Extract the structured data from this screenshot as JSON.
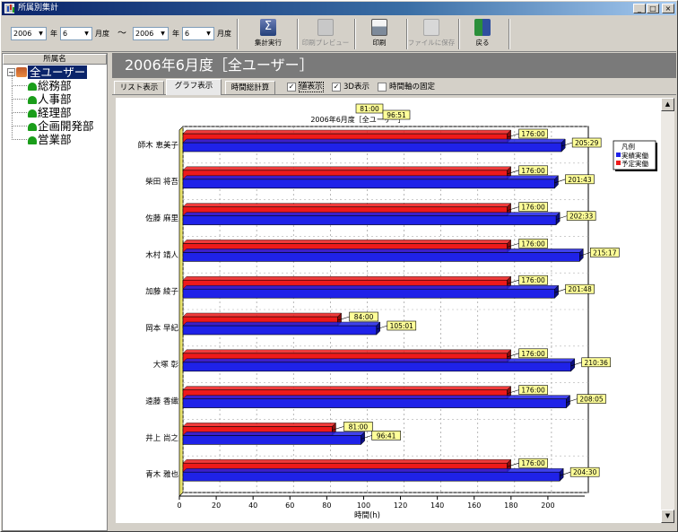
{
  "window": {
    "title": "所属別集計",
    "controls": [
      "_",
      "□",
      "×"
    ]
  },
  "toolbar": {
    "from_year": "2006",
    "year_label1": "年",
    "from_month": "6",
    "month_label1": "月度",
    "tilde": "～",
    "to_year": "2006",
    "year_label2": "年",
    "to_month": "6",
    "month_label2": "月度",
    "buttons": [
      {
        "label": "集計実行",
        "icon": "sigma-icon",
        "enabled": true
      },
      {
        "label": "印刷プレビュー",
        "icon": "print-preview-icon",
        "enabled": false
      },
      {
        "label": "印刷",
        "icon": "printer-icon",
        "enabled": true
      },
      {
        "label": "ファイルに保存",
        "icon": "save-file-icon",
        "enabled": false
      },
      {
        "label": "戻る",
        "icon": "exit-door-icon",
        "enabled": true
      }
    ]
  },
  "sidebar": {
    "header": "所属名",
    "root": "全ユーザー",
    "items": [
      "総務部",
      "人事部",
      "経理部",
      "企画開発部",
      "営業部"
    ]
  },
  "main": {
    "title": "2006年6月度［全ユーザー］",
    "tabs": [
      "リスト表示",
      "グラフ表示",
      "時間総計算"
    ],
    "checks": [
      {
        "label": "値表示",
        "checked": true
      },
      {
        "label": "3D表示",
        "checked": true
      },
      {
        "label": "時間軸の固定",
        "checked": false
      }
    ]
  },
  "chart_data": {
    "type": "bar",
    "orientation": "horizontal",
    "title": "2006年6月度［全ユーザー］",
    "xlabel": "時間(h)",
    "xlim": [
      0,
      220
    ],
    "xticks": [
      0,
      20,
      40,
      60,
      80,
      100,
      120,
      140,
      160,
      180,
      200
    ],
    "grid": true,
    "legend": {
      "title": "凡例",
      "position": "top-right"
    },
    "categories": [
      "師木 恵美子",
      "柴田 将吾",
      "佐藤 麻里",
      "木村 靖人",
      "加藤 綾子",
      "岡本 早紀",
      "大塚 彰",
      "遠藤 香織",
      "井上 尚之",
      "青木 雅也"
    ],
    "series": [
      {
        "name": "実績実働",
        "color": "#1f22e8",
        "values": [
          205.48,
          201.72,
          202.55,
          215.28,
          201.8,
          105.02,
          210.6,
          208.08,
          96.68,
          204.5
        ],
        "labels": [
          "205:29",
          "201:43",
          "202:33",
          "215:17",
          "201:48",
          "105:01",
          "210:36",
          "208:05",
          "96:41",
          "204:30"
        ]
      },
      {
        "name": "予定実働",
        "color": "#ee1a1a",
        "values": [
          176,
          176,
          176,
          176,
          176,
          84,
          176,
          176,
          81,
          176
        ],
        "labels": [
          "176:00",
          "176:00",
          "176:00",
          "176:00",
          "176:00",
          "84:00",
          "176:00",
          "176:00",
          "81:00",
          "176:00"
        ]
      }
    ],
    "top_annotations": [
      "81:00",
      "96:51"
    ],
    "colors": {
      "plot_bg": "#ffffff",
      "axis_yellow": "#e8e26a",
      "label_bg": "#ffff99"
    }
  }
}
